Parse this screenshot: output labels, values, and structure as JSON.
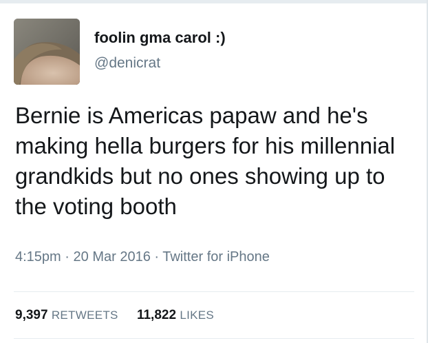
{
  "author": {
    "display_name": "foolin gma carol :)",
    "handle": "@denicrat"
  },
  "tweet": {
    "text": "Bernie is Americas papaw and he's making hella burgers for his millennial grandkids but no ones showing up to the voting booth",
    "time": "4:15pm",
    "date": "20 Mar 2016",
    "source": "Twitter for iPhone",
    "separator": "·"
  },
  "stats": {
    "retweets_count": "9,397",
    "retweets_label": "RETWEETS",
    "likes_count": "11,822",
    "likes_label": "LIKES"
  },
  "colors": {
    "text": "#14171a",
    "secondary": "#657786",
    "border": "#e6ecf0"
  }
}
